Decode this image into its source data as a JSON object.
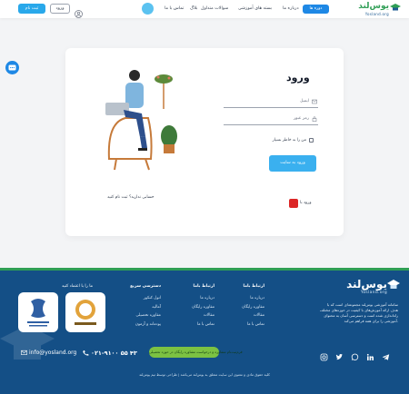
{
  "header": {
    "logo_word": "یوس‌لند",
    "logo_site": "Yosland.org",
    "nav_pill": "دوره ها",
    "nav": [
      "درباره ما",
      "بسته های آموزشی",
      "سوالات متداول",
      "بلاگ",
      "تماس با ما"
    ],
    "register_label": "ثبت نام",
    "login_label": "ورود"
  },
  "login": {
    "title": "ورود",
    "email_placeholder": "ایمیل",
    "password_placeholder": "رمز عبور",
    "remember_label": "من را به خاطر بسپار",
    "submit_label": "ورود به سایت",
    "signup_text": "حسابی ندارید؟ ثبت نام کنید",
    "otp_label": "ورود با"
  },
  "footer": {
    "logo_word": "یوس‌لند",
    "logo_site": "Yosland.org",
    "about": "سامانه آموزشی یوس‌لند مجموعه‌ای است که با هدف ارائه آموزش‌های با کیفیت در حوزه‌های مختلف راه‌اندازی شده است و دسترسی آسان به محتوای آموزشی را برای همه فراهم می‌کند.",
    "col_links": {
      "heading": "ارتباط باما",
      "items": [
        "درباره ما",
        "مقاوره رایگان",
        "مقالات",
        "تماس با ما"
      ]
    },
    "col_links2": {
      "heading": "ارتباط باما",
      "items": [
        "درباره ما",
        "مقاوره رایگان",
        "مقالات",
        "تماس با ما"
      ]
    },
    "col_access": {
      "heading": "دسترسی سریع",
      "items": [
        "اتول کنکور",
        "آمالیه",
        "مقاوره تحصیلی",
        "پودمانه و آزمون"
      ]
    },
    "trust_heading": "ما را با اعتماد کنید",
    "phone": "۰۲۱-۹۱۰۰ ۵۵ ۴۳",
    "email": "info@yosland.org",
    "green_button": "فرم‌ثبت‌نام مشاوره و درخواست مشاوره رایگان در حوزه تحصیلی",
    "copyright": "کلیه حقوق مادی و معنوی این سایت متعلق به یوس‌لند می‌باشد | طراحی توسط تیم یوس‌لند"
  },
  "colors": {
    "accent": "#1e88e5",
    "register_button": "#29a8ea",
    "submit_button": "#3ab0ef",
    "footer_bg": "#144f86",
    "footer_border": "#2f9e55",
    "green_button": "#7cc242",
    "otp_icon": "#dc2626",
    "logo_green": "#2f9e55"
  },
  "icons": [
    "graduation-cap-icon",
    "user-icon",
    "chat-icon",
    "mail-icon",
    "lock-icon",
    "phone-icon",
    "envelope-icon",
    "telegram-icon",
    "linkedin-icon",
    "youtube-icon",
    "whatsapp-icon",
    "twitter-icon",
    "instagram-icon"
  ]
}
